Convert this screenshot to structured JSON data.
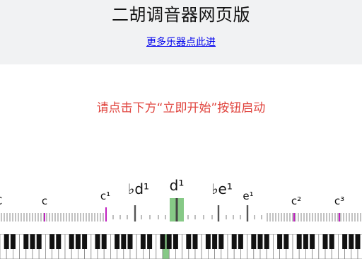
{
  "header": {
    "title": "二胡调音器网页版",
    "more_link": "更多乐器点此进"
  },
  "prompt": "请点击下方“立即开始”按钮启动",
  "tuner": {
    "highlight_color": "#86c986",
    "marker_color": "#c020c0",
    "labels": [
      {
        "name": "label-c-great",
        "text": "C",
        "size": "small"
      },
      {
        "name": "label-c-small",
        "text": "c",
        "size": "small"
      },
      {
        "name": "label-c1",
        "text": "c¹",
        "size": "small"
      },
      {
        "name": "label-bd1",
        "text": "♭d¹",
        "size": "large"
      },
      {
        "name": "label-d1",
        "text": "d¹",
        "size": "large"
      },
      {
        "name": "label-be1",
        "text": "♭e¹",
        "size": "large"
      },
      {
        "name": "label-e1",
        "text": "e¹",
        "size": "small"
      },
      {
        "name": "label-c2",
        "text": "c²",
        "size": "small"
      },
      {
        "name": "label-c3",
        "text": "c³",
        "size": "small"
      }
    ]
  },
  "keyboard": {
    "highlight_color": "#86c986"
  }
}
